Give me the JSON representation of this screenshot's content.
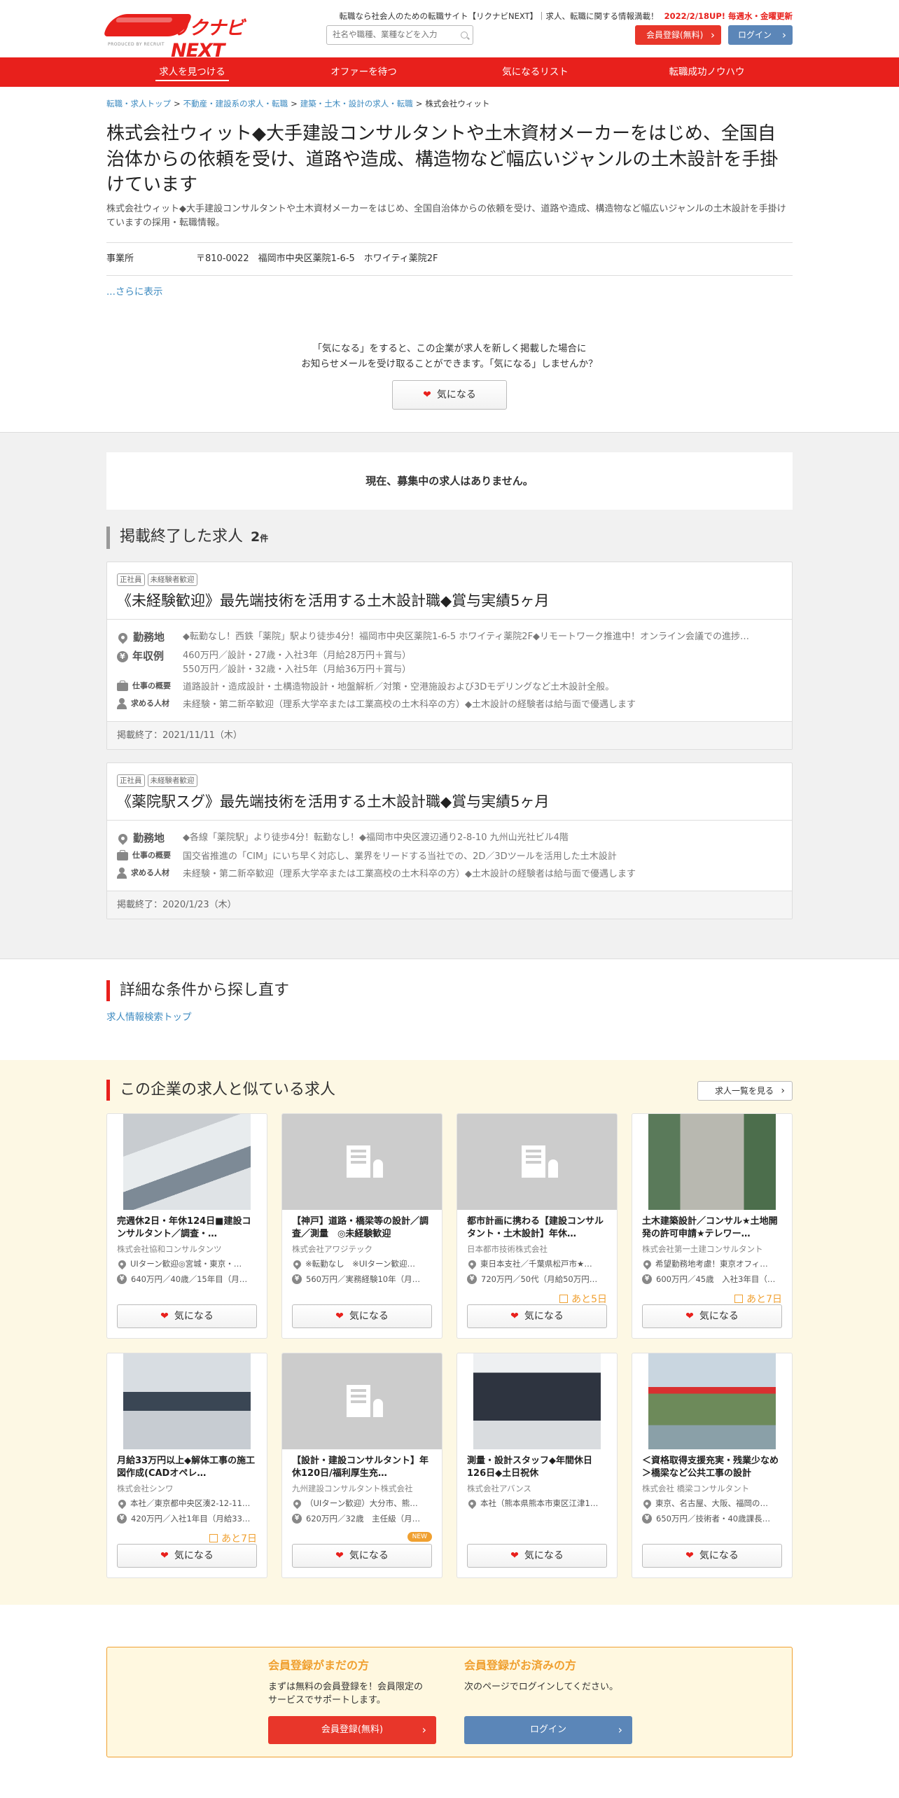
{
  "header": {
    "logo_text": "リクナビNEXT",
    "logo_sub": "PRODUCED BY RECRUIT",
    "top_text": "転職なら社会人のための転職サイト【リクナビNEXT】｜求人、転職に関する情報満載！",
    "update_text": "2022/2/18UP! 毎週水・金曜更新",
    "search_placeholder": "社名や職種、業種などを入力",
    "register_label": "会員登録(無料)",
    "login_label": "ログイン"
  },
  "nav": [
    "求人を見つける",
    "オファーを待つ",
    "気になるリスト",
    "転職成功ノウハウ"
  ],
  "breadcrumb": [
    "転職・求人トップ",
    "不動産・建設系の求人・転職",
    "建築・土木・設計の求人・転職",
    "株式会社ウィット"
  ],
  "company": {
    "title": "株式会社ウィット◆大手建設コンサルタントや土木資材メーカーをはじめ、全国自治体からの依頼を受け、道路や造成、構造物など幅広いジャンルの土木設計を手掛けています",
    "subtext": "株式会社ウィット◆大手建設コンサルタントや土木資材メーカーをはじめ、全国自治体からの依頼を受け、道路や造成、構造物など幅広いジャンルの土木設計を手掛けていますの採用・転職情報。",
    "office_label": "事業所",
    "office_value": "〒810-0022　福岡市中央区薬院1-6-5　ホワイティ薬院2F",
    "more": "...さらに表示"
  },
  "favorite": {
    "line1": "「気になる」をすると、この企業が求人を新しく掲載した場合に",
    "line2": "お知らせメールを受け取ることができます。「気になる」しませんか？",
    "button": "気になる"
  },
  "no_jobs": "現在、募集中の求人はありません。",
  "ended": {
    "title": "掲載終了した求人",
    "count": "2",
    "unit": "件",
    "jobs": [
      {
        "tags": [
          "正社員",
          "未経験者歓迎"
        ],
        "title": "《未経験歓迎》最先端技術を活用する土木設計職◆賞与実績5ヶ月",
        "location_label": "勤務地",
        "location": "◆転勤なし！西鉄「薬院」駅より徒歩4分！福岡市中央区薬院1-6-5 ホワイティ薬院2F◆リモートワーク推進中！オンライン会議での進捗…",
        "salary_label": "年収例",
        "salary1": "460万円／設計・27歳・入社3年（月給28万円＋賞与）",
        "salary2": "550万円／設計・32歳・入社5年（月給36万円＋賞与）",
        "summary_label": "仕事の概要",
        "summary": "道路設計・造成設計・土構造物設計・地盤解析／対策・空港施設および3Dモデリングなど土木設計全般。",
        "req_label": "求める人材",
        "req": "未経験・第二新卒歓迎（理系大学卒または工業高校の土木科卒の方）◆土木設計の経験者は給与面で優遇します",
        "ended": "掲載終了：2021/11/11（木）"
      },
      {
        "tags": [
          "正社員",
          "未経験者歓迎"
        ],
        "title": "《薬院駅スグ》最先端技術を活用する土木設計職◆賞与実績5ヶ月",
        "location_label": "勤務地",
        "location": "◆各線「薬院駅」より徒歩4分！転勤なし！◆福岡市中央区渡辺通り2-8-10 九州山光社ビル4階",
        "summary_label": "仕事の概要",
        "summary": "国交省推進の「CIM」にいち早く対応し、業界をリードする当社での、2D／3Dツールを活用した土木設計",
        "req_label": "求める人材",
        "req": "未経験・第二新卒歓迎（理系大学卒または工業高校の土木科卒の方）◆土木設計の経験者は給与面で優遇します",
        "ended": "掲載終了：2020/1/23（木）"
      }
    ]
  },
  "detail_search": {
    "title": "詳細な条件から探し直す",
    "link": "求人情報検索トップ"
  },
  "similar": {
    "title": "この企業の求人と似ている求人",
    "list_button": "求人一覧を見る",
    "fav_label": "気になる",
    "cards": [
      {
        "image": "meeting-photo",
        "title": "完週休2日・年休124日■建設コンサルタント／調査・…",
        "company": "株式会社協和コンサルタンツ",
        "loc": "UIターン歓迎◎宮城・東京・…",
        "salary": "640万円／40歳／15年目（月…",
        "badge": ""
      },
      {
        "image": "building-placeholder",
        "title": "【神戸】道路・橋梁等の設計／調査／測量　◎未経験歓迎",
        "company": "株式会社アワジテック",
        "loc": "※転勤なし　※UIターン歓迎…",
        "salary": "560万円／実務経験10年（月…",
        "badge": ""
      },
      {
        "image": "building-placeholder",
        "title": "都市計画に携わる【建設コンサルタント・土木設計】年休…",
        "company": "日本都市技術株式会社",
        "loc": "東日本支社／千葉県松戸市★…",
        "salary": "720万円／50代（月給50万円…",
        "badge": "あと5日"
      },
      {
        "image": "office-sign-photo",
        "title": "土木建築設計／コンサル★土地開発の許可申請★テレワー…",
        "company": "株式会社第一土建コンサルタント",
        "loc": "希望勤務地考慮！東京オフィ…",
        "salary": "600万円／45歳　入社3年目（…",
        "badge": "あと7日"
      },
      {
        "image": "desk-work-photo",
        "title": "月給33万円以上◆解体工事の施工図作成(CADオペレ…",
        "company": "株式会社シンワ",
        "loc": "本社／東京都中央区湊2-12-11…",
        "salary": "420万円／入社1年目（月給33…",
        "badge": "あと7日"
      },
      {
        "image": "building-placeholder",
        "title": "【設計・建設コンサルタント】年休120日/福利厚生充…",
        "company": "九州建設コンサルタント株式会社",
        "loc": "（UIターン歓迎）大分市、熊…",
        "salary": "620万円／32歳　主任級（月…",
        "badge": "NEW"
      },
      {
        "image": "monitor-photo",
        "title": "測量・設計スタッフ◆年間休日126日◆土日祝休",
        "company": "株式会社アバンス",
        "loc": "本社（熊本県熊本市東区江津1…",
        "salary": "",
        "badge": ""
      },
      {
        "image": "red-bridge-photo",
        "title": "＜資格取得支援充実・残業少なめ＞橋梁など公共工事の設計",
        "company": "株式会社 橋梁コンサルタント",
        "loc": "東京、名古屋、大阪、福岡の…",
        "salary": "650万円／技術者・40歳課長…",
        "badge": ""
      }
    ]
  },
  "bottom": {
    "left_title": "会員登録がまだの方",
    "left_text1": "まずは無料の会員登録を！会員限定の",
    "left_text2": "サービスでサポートします。",
    "left_button": "会員登録(無料)",
    "right_title": "会員登録がお済みの方",
    "right_text": "次のページでログインしてください。",
    "right_button": "ログイン"
  },
  "colors": {
    "brand_red": "#e8201c",
    "login_blue": "#5b86b8",
    "badge_orange": "#f0a030",
    "similar_bg": "#fdf8e4"
  }
}
